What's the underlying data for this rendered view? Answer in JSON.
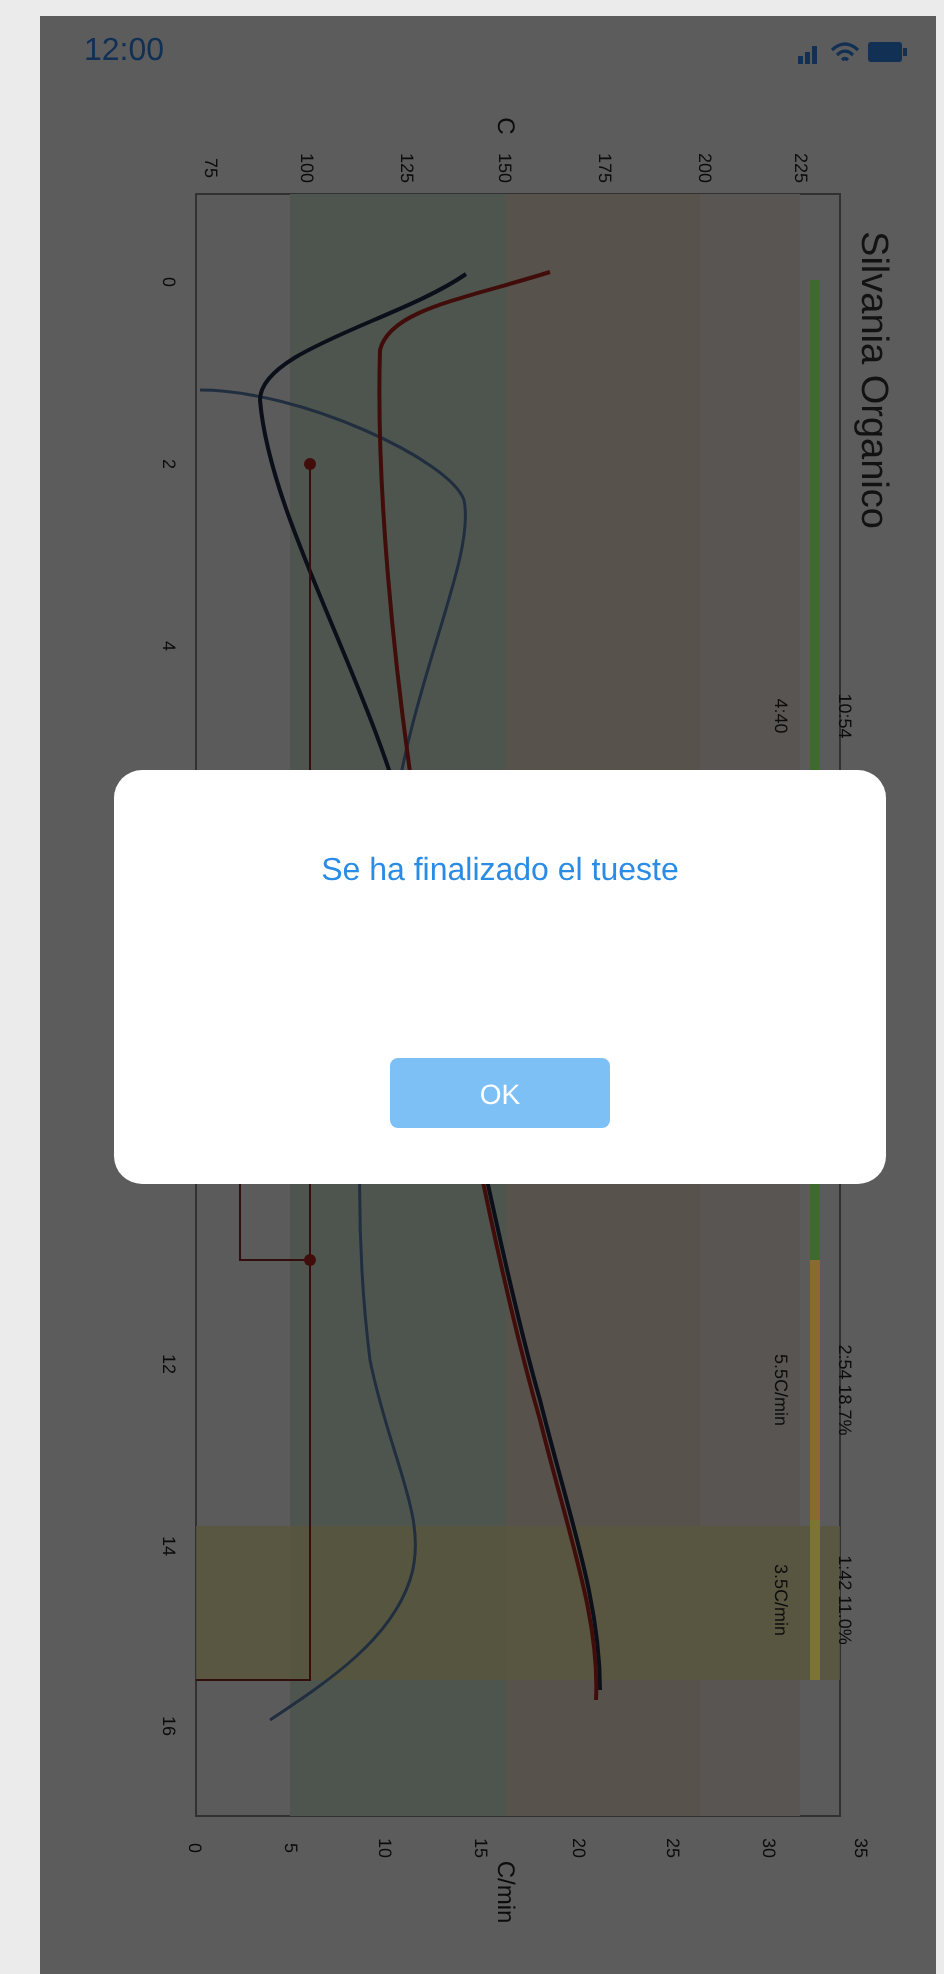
{
  "status_bar": {
    "time": "12:00"
  },
  "chart": {
    "title": "Silvania Organico",
    "temp_axis_label": "C",
    "rate_axis_label": "C/min",
    "temp_ticks": [
      "75",
      "100",
      "125",
      "150",
      "175",
      "200",
      "225"
    ],
    "rate_ticks": [
      "0",
      "5",
      "10",
      "15",
      "20",
      "25",
      "30",
      "35"
    ],
    "time_ticks": [
      "0",
      "2",
      "4",
      "12",
      "14",
      "16"
    ],
    "phases": [
      {
        "summary": "10:54",
        "detail": "4:40",
        "color": "#3e6b2c"
      },
      {
        "summary": "2:54  18.7%",
        "detail": "5.5C/min",
        "color": "#8a6a2e"
      },
      {
        "summary": "1:42  11.0%",
        "detail": "3.5C/min",
        "color": "#7e7432"
      }
    ]
  },
  "dialog": {
    "message": "Se ha finalizado el tueste",
    "button": "OK"
  }
}
